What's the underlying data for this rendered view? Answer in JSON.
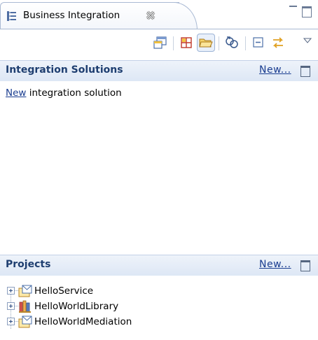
{
  "view": {
    "tab_title": "Business Integration",
    "close_glyph": "⛝"
  },
  "toolbar": {
    "buttons": [
      {
        "name": "open-solution-icon"
      },
      {
        "name": "show-grid-icon"
      },
      {
        "name": "open-folder-icon"
      },
      {
        "name": "link-icon"
      },
      {
        "name": "collapse-all-icon"
      },
      {
        "name": "sync-arrows-icon"
      }
    ]
  },
  "integration_solutions": {
    "title": "Integration Solutions",
    "new_label": "New...",
    "new_link_text": "New",
    "new_link_suffix": " integration solution"
  },
  "projects": {
    "title": "Projects",
    "new_label": "New...",
    "items": [
      {
        "label": "HelloService",
        "icon": "module-envelope-icon"
      },
      {
        "label": "HelloWorldLibrary",
        "icon": "library-icon"
      },
      {
        "label": "HelloWorldMediation",
        "icon": "module-envelope-icon"
      }
    ]
  },
  "colors": {
    "accent": "#1e3e70",
    "link": "#1a3d90",
    "header_bg": "#dde7f5",
    "border": "#a9b9d3"
  }
}
